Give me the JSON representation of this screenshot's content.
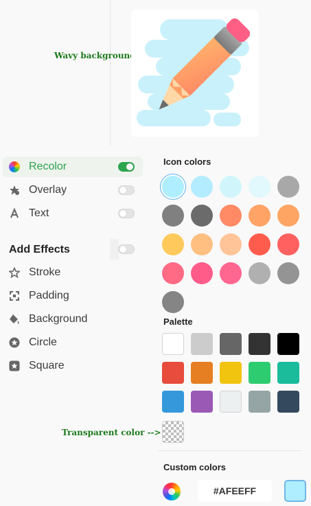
{
  "annotations": {
    "wavy": "Wavy background -->",
    "transparent": "Transparent color -->"
  },
  "menu": {
    "items": [
      {
        "label": "Recolor",
        "icon": "color-wheel-icon",
        "active": true,
        "toggle": true
      },
      {
        "label": "Overlay",
        "icon": "overlay-icon",
        "toggle": false
      },
      {
        "label": "Text",
        "icon": "text-icon",
        "toggle": false
      }
    ],
    "effects_title": "Add Effects",
    "effects_toggle": false,
    "effects": [
      {
        "label": "Stroke",
        "icon": "star-outline-icon"
      },
      {
        "label": "Padding",
        "icon": "padding-icon"
      },
      {
        "label": "Background",
        "icon": "paint-bucket-icon"
      },
      {
        "label": "Circle",
        "icon": "circle-star-icon"
      },
      {
        "label": "Square",
        "icon": "square-star-icon"
      }
    ]
  },
  "icon_colors": {
    "title": "Icon colors",
    "selected": "#afeeff",
    "swatches": [
      "#afeeff",
      "#b3ecff",
      "#d0f6fc",
      "#e1f8fd",
      "#a8a8a8",
      "#808080",
      "#6b6b6b",
      "#ff8a65",
      "#ffa366",
      "#ffa564",
      "#ffc95c",
      "#ffbf80",
      "#ffc498",
      "#ff5c4d",
      "#ff6161",
      "#ff6a85",
      "#ff5c8a",
      "#ff6690",
      "#b0b0b0",
      "#949494",
      "#858585"
    ]
  },
  "palette": {
    "title": "Palette",
    "colors": [
      "#ffffff",
      "#cccccc",
      "#666666",
      "#333333",
      "#000000",
      "#e74c3c",
      "#e67e22",
      "#f1c40f",
      "#2ecc71",
      "#1abc9c",
      "#3498db",
      "#9b59b6",
      "#ecf0f1",
      "#95a5a6",
      "#34495e"
    ]
  },
  "custom": {
    "title": "Custom colors",
    "hex": "#AFEEFF",
    "current": "#afeeff"
  },
  "colors": {
    "accent": "#2da44e",
    "annotation": "#1c7a1c"
  }
}
